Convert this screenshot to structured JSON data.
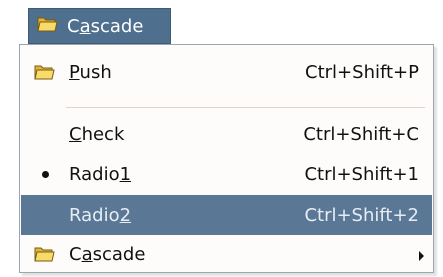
{
  "menubar": {
    "item": {
      "pre": "C",
      "mn": "a",
      "post": "scade",
      "icon": "folder-open-icon"
    }
  },
  "menu": {
    "items": [
      {
        "type": "push",
        "pre": "",
        "mn": "P",
        "post": "ush",
        "shortcut": "Ctrl+Shift+P",
        "icon": "folder-open-icon"
      },
      {
        "type": "check",
        "pre": "",
        "mn": "C",
        "post": "heck",
        "shortcut": "Ctrl+Shift+C"
      },
      {
        "type": "radio",
        "pre": "Radio",
        "mn": "1",
        "post": "",
        "shortcut": "Ctrl+Shift+1",
        "selected": true
      },
      {
        "type": "radio",
        "pre": "Radio",
        "mn": "2",
        "post": "",
        "shortcut": "Ctrl+Shift+2",
        "highlighted": true
      },
      {
        "type": "cascade",
        "pre": "C",
        "mn": "a",
        "post": "scade",
        "shortcut": "",
        "icon": "folder-open-icon",
        "submenu_icon": "chevron-right-icon"
      }
    ]
  },
  "colors": {
    "menubar_active_bg": "#4f6f8f",
    "highlight_bg": "#5a7895",
    "highlight_text": "#e6edf4",
    "menu_bg": "#fdfcfb",
    "separator": "#e6d3c8"
  }
}
